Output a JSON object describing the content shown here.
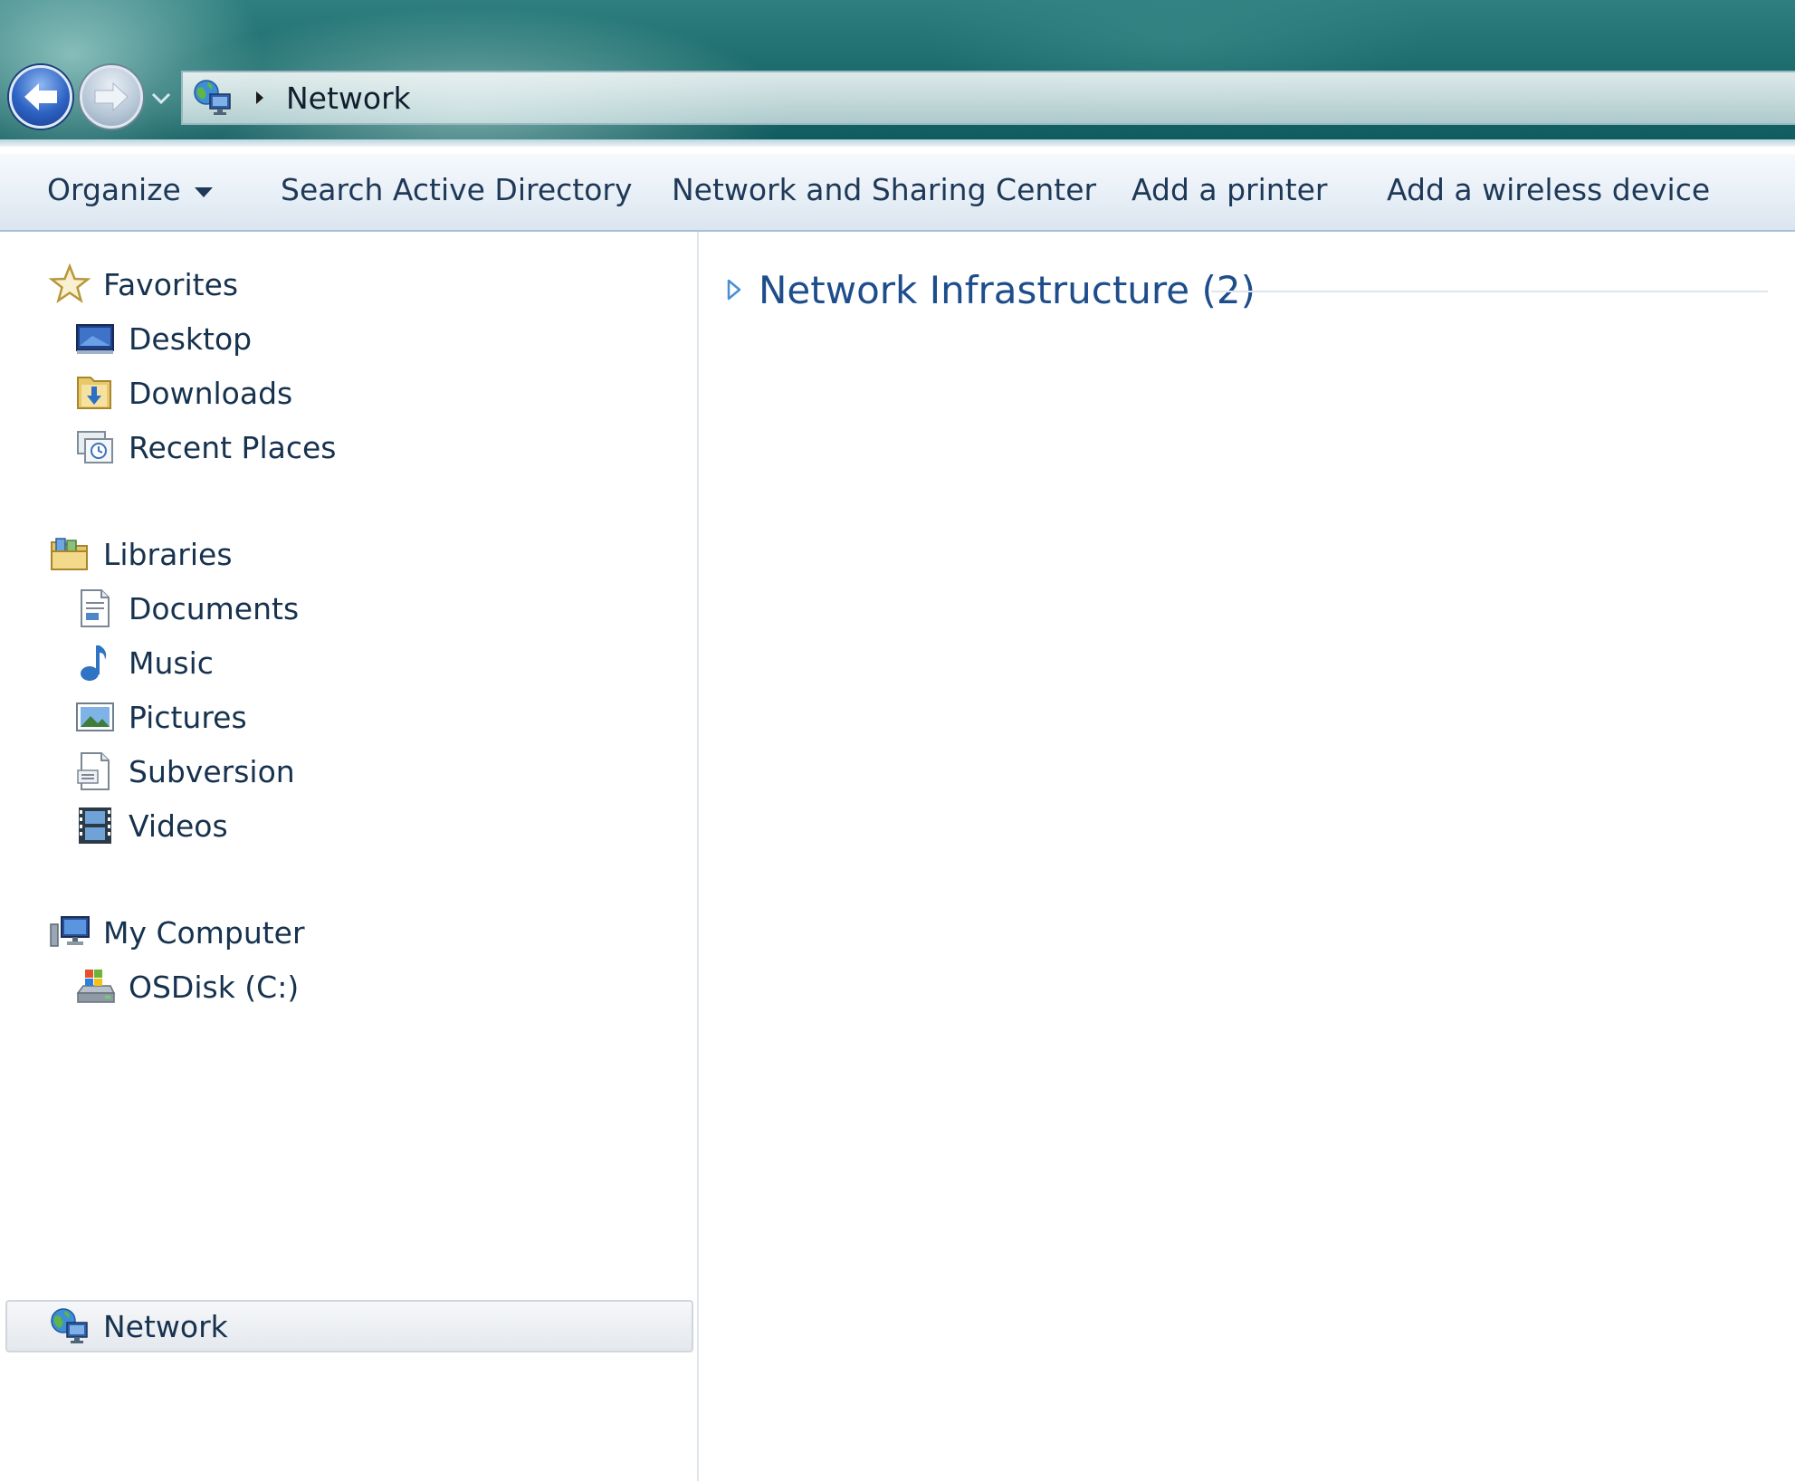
{
  "address_bar": {
    "location_icon": "network-icon",
    "breadcrumb_separator": "▸",
    "path": "Network"
  },
  "nav_buttons": {
    "back_icon": "back-arrow-icon",
    "forward_icon": "forward-arrow-icon",
    "recent_icon": "chevron-down-icon"
  },
  "command_bar": {
    "organize": "Organize",
    "search_active_directory": "Search Active Directory",
    "network_and_sharing_center": "Network and Sharing Center",
    "add_a_printer": "Add a printer",
    "add_a_wireless_device": "Add a wireless device"
  },
  "navigation": {
    "favorites": {
      "label": "Favorites",
      "icon": "star-icon",
      "items": [
        {
          "label": "Desktop",
          "icon": "desktop-icon"
        },
        {
          "label": "Downloads",
          "icon": "downloads-icon"
        },
        {
          "label": "Recent Places",
          "icon": "recent-places-icon"
        }
      ]
    },
    "libraries": {
      "label": "Libraries",
      "icon": "libraries-icon",
      "items": [
        {
          "label": "Documents",
          "icon": "documents-icon"
        },
        {
          "label": "Music",
          "icon": "music-icon"
        },
        {
          "label": "Pictures",
          "icon": "pictures-icon"
        },
        {
          "label": "Subversion",
          "icon": "subversion-icon"
        },
        {
          "label": "Videos",
          "icon": "videos-icon"
        }
      ]
    },
    "computer": {
      "label": "My Computer",
      "icon": "computer-icon",
      "items": [
        {
          "label": "OSDisk (C:)",
          "icon": "disk-drive-icon"
        }
      ]
    },
    "network": {
      "label": "Network",
      "icon": "network-icon",
      "selected": true
    }
  },
  "content": {
    "groups": [
      {
        "title": "Network Infrastructure (2)",
        "expanded": false,
        "toggle_icon": "expand-triangle-icon"
      }
    ]
  },
  "colors": {
    "title_glass": "#1d6d6e",
    "command_bar": "#e9f0f7",
    "group_title": "#1e4d8c",
    "text": "#16324e"
  }
}
